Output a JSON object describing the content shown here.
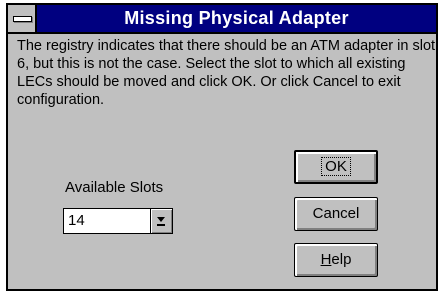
{
  "window": {
    "title": "Missing Physical Adapter"
  },
  "message": "The registry indicates that there should be an ATM adapter in slot 6, but this is not the case. Select the slot to which all existing LECs should be moved and click OK. Or click Cancel to exit configuration.",
  "slots": {
    "label": "Available Slots",
    "selected": "14"
  },
  "buttons": {
    "ok": "OK",
    "cancel": "Cancel",
    "help_mnemonic": "H",
    "help_rest": "elp"
  },
  "icons": {
    "system_menu": "system-menu-icon",
    "dropdown": "dropdown-arrow-icon"
  },
  "colors": {
    "titlebar": "#000080",
    "face": "#c0c0c0"
  }
}
